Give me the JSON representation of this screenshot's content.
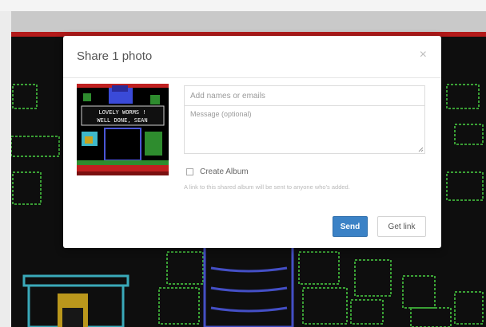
{
  "dialog": {
    "title": "Share 1 photo",
    "close_glyph": "×",
    "names_placeholder": "Add names or emails",
    "message_placeholder": "Message (optional)",
    "create_album_label": "Create Album",
    "create_album_checked": false,
    "hint": "A link to this shared album will be sent to anyone who's added.",
    "send_label": "Send",
    "get_link_label": "Get link"
  },
  "thumbnail": {
    "text_line1": "LOVELY WORMS !",
    "text_line2": "WELL DONE, SEAN"
  },
  "colors": {
    "accent": "#3b82c6",
    "top_red_bar": "#b31a1a",
    "game_background": "#101010",
    "game_green": "#3fae3a",
    "game_blue": "#4a56d6",
    "game_cyan": "#3fb8c9"
  },
  "icons": {
    "close": "close-icon",
    "checkbox": "checkbox-icon",
    "resize": "resize-grip-icon"
  }
}
